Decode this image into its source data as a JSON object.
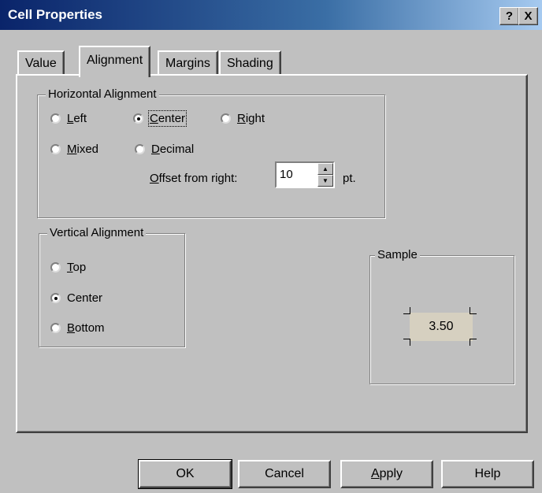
{
  "window": {
    "title": "Cell Properties",
    "help_glyph": "?",
    "close_glyph": "X"
  },
  "tabs": [
    {
      "label": "Value",
      "active": false
    },
    {
      "label": "Alignment",
      "active": true
    },
    {
      "label": "Margins",
      "active": false
    },
    {
      "label": "Shading",
      "active": false
    }
  ],
  "horizontal": {
    "legend": "Horizontal Alignment",
    "left": {
      "key": "L",
      "rest": "eft"
    },
    "center": {
      "key": "C",
      "rest": "enter"
    },
    "right": {
      "key": "R",
      "rest": "ight"
    },
    "mixed": {
      "key": "M",
      "rest": "ixed"
    },
    "decimal": {
      "key": "D",
      "rest": "ecimal"
    },
    "offset_label_key": "O",
    "offset_label_rest": "ffset from right:",
    "offset_value": "10",
    "offset_unit": "pt.",
    "selected": "Center"
  },
  "vertical": {
    "legend": "Vertical Alignment",
    "top": {
      "key": "T",
      "rest": "op"
    },
    "center": {
      "key": "C",
      "rest": "enter"
    },
    "bottom": {
      "key": "B",
      "rest": "ottom"
    },
    "selected": "Center"
  },
  "sample": {
    "legend": "Sample",
    "value": "3.50"
  },
  "buttons": {
    "ok": "OK",
    "cancel": "Cancel",
    "apply_key": "A",
    "apply_rest": "pply",
    "help": "Help"
  }
}
